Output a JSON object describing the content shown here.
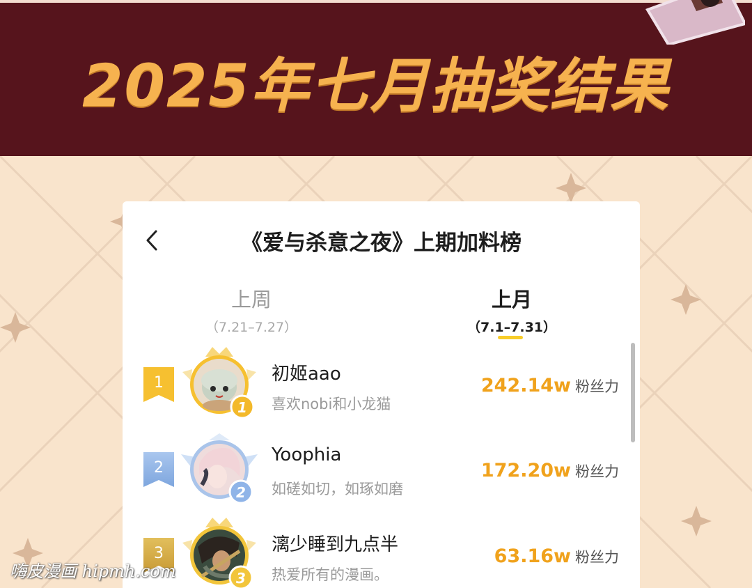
{
  "banner": {
    "title": "2025年七月抽奖结果"
  },
  "card": {
    "title": "《爱与杀意之夜》上期加料榜",
    "back_icon": "chevron-left-icon"
  },
  "tabs": [
    {
      "label": "上周",
      "range": "（7.21–7.27）",
      "active": false
    },
    {
      "label": "上月",
      "range": "（7.1–7.31）",
      "active": true
    }
  ],
  "ranking": [
    {
      "rank": "1",
      "badge_number": "1",
      "name": "初姬aao",
      "bio": "喜欢nobi和小龙猫",
      "score": "242.14w",
      "unit": "粉丝力",
      "badge_color": "#f6c030",
      "frame_color": "#f6c030"
    },
    {
      "rank": "2",
      "badge_number": "2",
      "name": "Yoophia",
      "bio": "如磋如切，如琢如磨",
      "score": "172.20w",
      "unit": "粉丝力",
      "badge_color": "#8fb4e8",
      "frame_color": "#9cbde8"
    },
    {
      "rank": "3",
      "badge_number": "3",
      "name": "漓少睡到九点半",
      "bio": "热爱所有的漫画。",
      "score": "63.16w",
      "unit": "粉丝力",
      "badge_color": "#d4ac46",
      "frame_color": "#f2c53b"
    }
  ],
  "watermark": "嗨皮漫画 hipmh.com",
  "colors": {
    "banner_bg": "#56141c",
    "title_gold": "#f6b24f",
    "page_bg": "#f9e4cc",
    "accent_yellow": "#f8cd2a",
    "score_orange": "#f0a21c"
  }
}
